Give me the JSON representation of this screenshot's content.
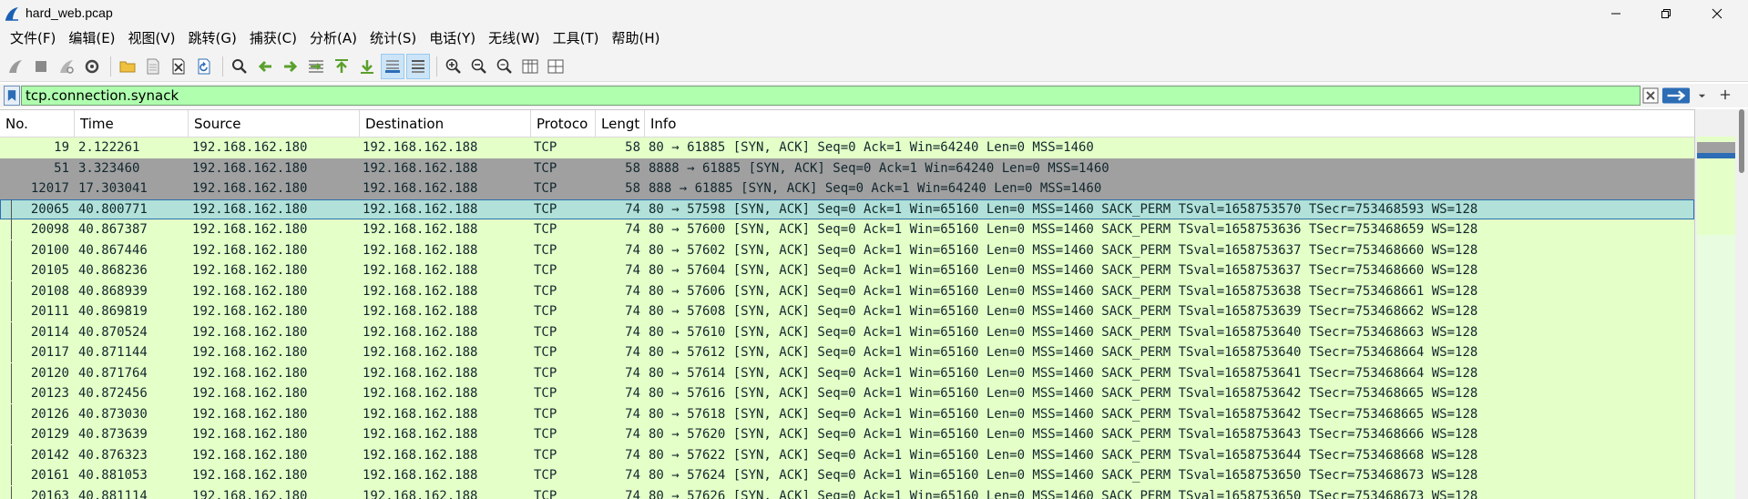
{
  "window": {
    "title": "hard_web.pcap",
    "controls": {
      "minimize": "minimize",
      "maximize": "maximize",
      "close": "close"
    }
  },
  "menu": [
    "文件(F)",
    "编辑(E)",
    "视图(V)",
    "跳转(G)",
    "捕获(C)",
    "分析(A)",
    "统计(S)",
    "电话(Y)",
    "无线(W)",
    "工具(T)",
    "帮助(H)"
  ],
  "toolbar": {
    "icons": [
      "shark-fin-start-icon",
      "stop-square-icon",
      "restart-fin-icon",
      "capture-options-gear-icon",
      "open-folder-icon",
      "save-file-icon",
      "close-file-icon",
      "reload-icon",
      "find-magnifier-icon",
      "go-back-arrow-icon",
      "go-forward-arrow-icon",
      "go-to-packet-icon",
      "go-first-icon",
      "go-last-icon",
      "autoscroll-icon",
      "colorize-icon",
      "zoom-in-icon",
      "zoom-out-icon",
      "zoom-reset-icon",
      "resize-columns-icon",
      "layout-icon"
    ]
  },
  "filter": {
    "value": "tcp.connection.synack"
  },
  "packet_list": {
    "columns": [
      "No.",
      "Time",
      "Source",
      "Destination",
      "Protoco",
      "Lengt",
      "Info"
    ],
    "colors": {
      "normal_bg": "#e4ffc7",
      "gray_bg": "#a0a0a0",
      "selected_bg": "#b1e1d8",
      "text": "#12272e"
    },
    "rows": [
      {
        "no": "19",
        "time": "2.122261",
        "src": "192.168.162.180",
        "dst": "192.168.162.188",
        "proto": "TCP",
        "len": "58",
        "info": "80 → 61885 [SYN, ACK] Seq=0 Ack=1 Win=64240 Len=0 MSS=1460",
        "style": "normal"
      },
      {
        "no": "51",
        "time": "3.323460",
        "src": "192.168.162.180",
        "dst": "192.168.162.188",
        "proto": "TCP",
        "len": "58",
        "info": "8888 → 61885 [SYN, ACK] Seq=0 Ack=1 Win=64240 Len=0 MSS=1460",
        "style": "gray"
      },
      {
        "no": "12017",
        "time": "17.303041",
        "src": "192.168.162.180",
        "dst": "192.168.162.188",
        "proto": "TCP",
        "len": "58",
        "info": "888 → 61885 [SYN, ACK] Seq=0 Ack=1 Win=64240 Len=0 MSS=1460",
        "style": "gray"
      },
      {
        "no": "20065",
        "time": "40.800771",
        "src": "192.168.162.180",
        "dst": "192.168.162.188",
        "proto": "TCP",
        "len": "74",
        "info": "80 → 57598 [SYN, ACK] Seq=0 Ack=1 Win=65160 Len=0 MSS=1460 SACK_PERM TSval=1658753570 TSecr=753468593 WS=128",
        "style": "selected"
      },
      {
        "no": "20098",
        "time": "40.867387",
        "src": "192.168.162.180",
        "dst": "192.168.162.188",
        "proto": "TCP",
        "len": "74",
        "info": "80 → 57600 [SYN, ACK] Seq=0 Ack=1 Win=65160 Len=0 MSS=1460 SACK_PERM TSval=1658753636 TSecr=753468659 WS=128",
        "style": "normal"
      },
      {
        "no": "20100",
        "time": "40.867446",
        "src": "192.168.162.180",
        "dst": "192.168.162.188",
        "proto": "TCP",
        "len": "74",
        "info": "80 → 57602 [SYN, ACK] Seq=0 Ack=1 Win=65160 Len=0 MSS=1460 SACK_PERM TSval=1658753637 TSecr=753468660 WS=128",
        "style": "normal"
      },
      {
        "no": "20105",
        "time": "40.868236",
        "src": "192.168.162.180",
        "dst": "192.168.162.188",
        "proto": "TCP",
        "len": "74",
        "info": "80 → 57604 [SYN, ACK] Seq=0 Ack=1 Win=65160 Len=0 MSS=1460 SACK_PERM TSval=1658753637 TSecr=753468660 WS=128",
        "style": "normal"
      },
      {
        "no": "20108",
        "time": "40.868939",
        "src": "192.168.162.180",
        "dst": "192.168.162.188",
        "proto": "TCP",
        "len": "74",
        "info": "80 → 57606 [SYN, ACK] Seq=0 Ack=1 Win=65160 Len=0 MSS=1460 SACK_PERM TSval=1658753638 TSecr=753468661 WS=128",
        "style": "normal"
      },
      {
        "no": "20111",
        "time": "40.869819",
        "src": "192.168.162.180",
        "dst": "192.168.162.188",
        "proto": "TCP",
        "len": "74",
        "info": "80 → 57608 [SYN, ACK] Seq=0 Ack=1 Win=65160 Len=0 MSS=1460 SACK_PERM TSval=1658753639 TSecr=753468662 WS=128",
        "style": "normal"
      },
      {
        "no": "20114",
        "time": "40.870524",
        "src": "192.168.162.180",
        "dst": "192.168.162.188",
        "proto": "TCP",
        "len": "74",
        "info": "80 → 57610 [SYN, ACK] Seq=0 Ack=1 Win=65160 Len=0 MSS=1460 SACK_PERM TSval=1658753640 TSecr=753468663 WS=128",
        "style": "normal"
      },
      {
        "no": "20117",
        "time": "40.871144",
        "src": "192.168.162.180",
        "dst": "192.168.162.188",
        "proto": "TCP",
        "len": "74",
        "info": "80 → 57612 [SYN, ACK] Seq=0 Ack=1 Win=65160 Len=0 MSS=1460 SACK_PERM TSval=1658753640 TSecr=753468664 WS=128",
        "style": "normal"
      },
      {
        "no": "20120",
        "time": "40.871764",
        "src": "192.168.162.180",
        "dst": "192.168.162.188",
        "proto": "TCP",
        "len": "74",
        "info": "80 → 57614 [SYN, ACK] Seq=0 Ack=1 Win=65160 Len=0 MSS=1460 SACK_PERM TSval=1658753641 TSecr=753468664 WS=128",
        "style": "normal"
      },
      {
        "no": "20123",
        "time": "40.872456",
        "src": "192.168.162.180",
        "dst": "192.168.162.188",
        "proto": "TCP",
        "len": "74",
        "info": "80 → 57616 [SYN, ACK] Seq=0 Ack=1 Win=65160 Len=0 MSS=1460 SACK_PERM TSval=1658753642 TSecr=753468665 WS=128",
        "style": "normal"
      },
      {
        "no": "20126",
        "time": "40.873030",
        "src": "192.168.162.180",
        "dst": "192.168.162.188",
        "proto": "TCP",
        "len": "74",
        "info": "80 → 57618 [SYN, ACK] Seq=0 Ack=1 Win=65160 Len=0 MSS=1460 SACK_PERM TSval=1658753642 TSecr=753468665 WS=128",
        "style": "normal"
      },
      {
        "no": "20129",
        "time": "40.873639",
        "src": "192.168.162.180",
        "dst": "192.168.162.188",
        "proto": "TCP",
        "len": "74",
        "info": "80 → 57620 [SYN, ACK] Seq=0 Ack=1 Win=65160 Len=0 MSS=1460 SACK_PERM TSval=1658753643 TSecr=753468666 WS=128",
        "style": "normal"
      },
      {
        "no": "20142",
        "time": "40.876323",
        "src": "192.168.162.180",
        "dst": "192.168.162.188",
        "proto": "TCP",
        "len": "74",
        "info": "80 → 57622 [SYN, ACK] Seq=0 Ack=1 Win=65160 Len=0 MSS=1460 SACK_PERM TSval=1658753644 TSecr=753468668 WS=128",
        "style": "normal"
      },
      {
        "no": "20161",
        "time": "40.881053",
        "src": "192.168.162.180",
        "dst": "192.168.162.188",
        "proto": "TCP",
        "len": "74",
        "info": "80 → 57624 [SYN, ACK] Seq=0 Ack=1 Win=65160 Len=0 MSS=1460 SACK_PERM TSval=1658753650 TSecr=753468673 WS=128",
        "style": "normal"
      },
      {
        "no": "20163",
        "time": "40.881114",
        "src": "192.168.162.180",
        "dst": "192.168.162.188",
        "proto": "TCP",
        "len": "74",
        "info": "80 → 57626 [SYN, ACK] Seq=0 Ack=1 Win=65160 Len=0 MSS=1460 SACK_PERM TSval=1658753650 TSecr=753468673 WS=128",
        "style": "normal"
      }
    ]
  }
}
